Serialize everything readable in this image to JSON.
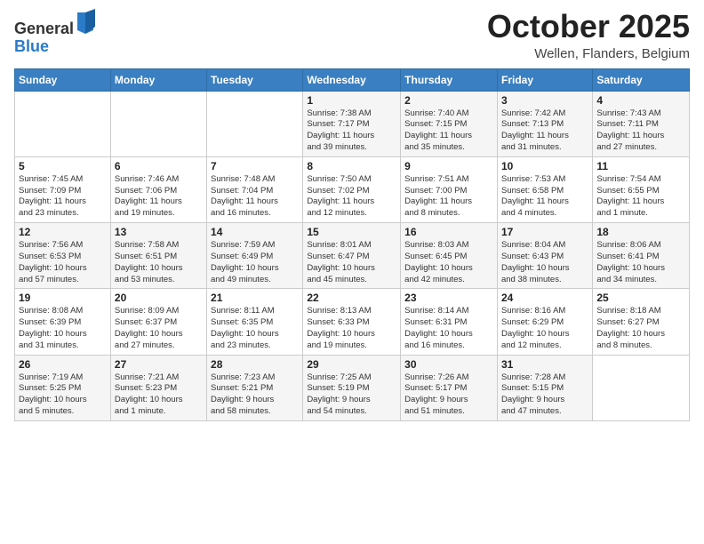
{
  "logo": {
    "general": "General",
    "blue": "Blue"
  },
  "header": {
    "month": "October 2025",
    "location": "Wellen, Flanders, Belgium"
  },
  "weekdays": [
    "Sunday",
    "Monday",
    "Tuesday",
    "Wednesday",
    "Thursday",
    "Friday",
    "Saturday"
  ],
  "weeks": [
    [
      {
        "day": "",
        "info": ""
      },
      {
        "day": "",
        "info": ""
      },
      {
        "day": "",
        "info": ""
      },
      {
        "day": "1",
        "info": "Sunrise: 7:38 AM\nSunset: 7:17 PM\nDaylight: 11 hours\nand 39 minutes."
      },
      {
        "day": "2",
        "info": "Sunrise: 7:40 AM\nSunset: 7:15 PM\nDaylight: 11 hours\nand 35 minutes."
      },
      {
        "day": "3",
        "info": "Sunrise: 7:42 AM\nSunset: 7:13 PM\nDaylight: 11 hours\nand 31 minutes."
      },
      {
        "day": "4",
        "info": "Sunrise: 7:43 AM\nSunset: 7:11 PM\nDaylight: 11 hours\nand 27 minutes."
      }
    ],
    [
      {
        "day": "5",
        "info": "Sunrise: 7:45 AM\nSunset: 7:09 PM\nDaylight: 11 hours\nand 23 minutes."
      },
      {
        "day": "6",
        "info": "Sunrise: 7:46 AM\nSunset: 7:06 PM\nDaylight: 11 hours\nand 19 minutes."
      },
      {
        "day": "7",
        "info": "Sunrise: 7:48 AM\nSunset: 7:04 PM\nDaylight: 11 hours\nand 16 minutes."
      },
      {
        "day": "8",
        "info": "Sunrise: 7:50 AM\nSunset: 7:02 PM\nDaylight: 11 hours\nand 12 minutes."
      },
      {
        "day": "9",
        "info": "Sunrise: 7:51 AM\nSunset: 7:00 PM\nDaylight: 11 hours\nand 8 minutes."
      },
      {
        "day": "10",
        "info": "Sunrise: 7:53 AM\nSunset: 6:58 PM\nDaylight: 11 hours\nand 4 minutes."
      },
      {
        "day": "11",
        "info": "Sunrise: 7:54 AM\nSunset: 6:55 PM\nDaylight: 11 hours\nand 1 minute."
      }
    ],
    [
      {
        "day": "12",
        "info": "Sunrise: 7:56 AM\nSunset: 6:53 PM\nDaylight: 10 hours\nand 57 minutes."
      },
      {
        "day": "13",
        "info": "Sunrise: 7:58 AM\nSunset: 6:51 PM\nDaylight: 10 hours\nand 53 minutes."
      },
      {
        "day": "14",
        "info": "Sunrise: 7:59 AM\nSunset: 6:49 PM\nDaylight: 10 hours\nand 49 minutes."
      },
      {
        "day": "15",
        "info": "Sunrise: 8:01 AM\nSunset: 6:47 PM\nDaylight: 10 hours\nand 45 minutes."
      },
      {
        "day": "16",
        "info": "Sunrise: 8:03 AM\nSunset: 6:45 PM\nDaylight: 10 hours\nand 42 minutes."
      },
      {
        "day": "17",
        "info": "Sunrise: 8:04 AM\nSunset: 6:43 PM\nDaylight: 10 hours\nand 38 minutes."
      },
      {
        "day": "18",
        "info": "Sunrise: 8:06 AM\nSunset: 6:41 PM\nDaylight: 10 hours\nand 34 minutes."
      }
    ],
    [
      {
        "day": "19",
        "info": "Sunrise: 8:08 AM\nSunset: 6:39 PM\nDaylight: 10 hours\nand 31 minutes."
      },
      {
        "day": "20",
        "info": "Sunrise: 8:09 AM\nSunset: 6:37 PM\nDaylight: 10 hours\nand 27 minutes."
      },
      {
        "day": "21",
        "info": "Sunrise: 8:11 AM\nSunset: 6:35 PM\nDaylight: 10 hours\nand 23 minutes."
      },
      {
        "day": "22",
        "info": "Sunrise: 8:13 AM\nSunset: 6:33 PM\nDaylight: 10 hours\nand 19 minutes."
      },
      {
        "day": "23",
        "info": "Sunrise: 8:14 AM\nSunset: 6:31 PM\nDaylight: 10 hours\nand 16 minutes."
      },
      {
        "day": "24",
        "info": "Sunrise: 8:16 AM\nSunset: 6:29 PM\nDaylight: 10 hours\nand 12 minutes."
      },
      {
        "day": "25",
        "info": "Sunrise: 8:18 AM\nSunset: 6:27 PM\nDaylight: 10 hours\nand 8 minutes."
      }
    ],
    [
      {
        "day": "26",
        "info": "Sunrise: 7:19 AM\nSunset: 5:25 PM\nDaylight: 10 hours\nand 5 minutes."
      },
      {
        "day": "27",
        "info": "Sunrise: 7:21 AM\nSunset: 5:23 PM\nDaylight: 10 hours\nand 1 minute."
      },
      {
        "day": "28",
        "info": "Sunrise: 7:23 AM\nSunset: 5:21 PM\nDaylight: 9 hours\nand 58 minutes."
      },
      {
        "day": "29",
        "info": "Sunrise: 7:25 AM\nSunset: 5:19 PM\nDaylight: 9 hours\nand 54 minutes."
      },
      {
        "day": "30",
        "info": "Sunrise: 7:26 AM\nSunset: 5:17 PM\nDaylight: 9 hours\nand 51 minutes."
      },
      {
        "day": "31",
        "info": "Sunrise: 7:28 AM\nSunset: 5:15 PM\nDaylight: 9 hours\nand 47 minutes."
      },
      {
        "day": "",
        "info": ""
      }
    ]
  ]
}
